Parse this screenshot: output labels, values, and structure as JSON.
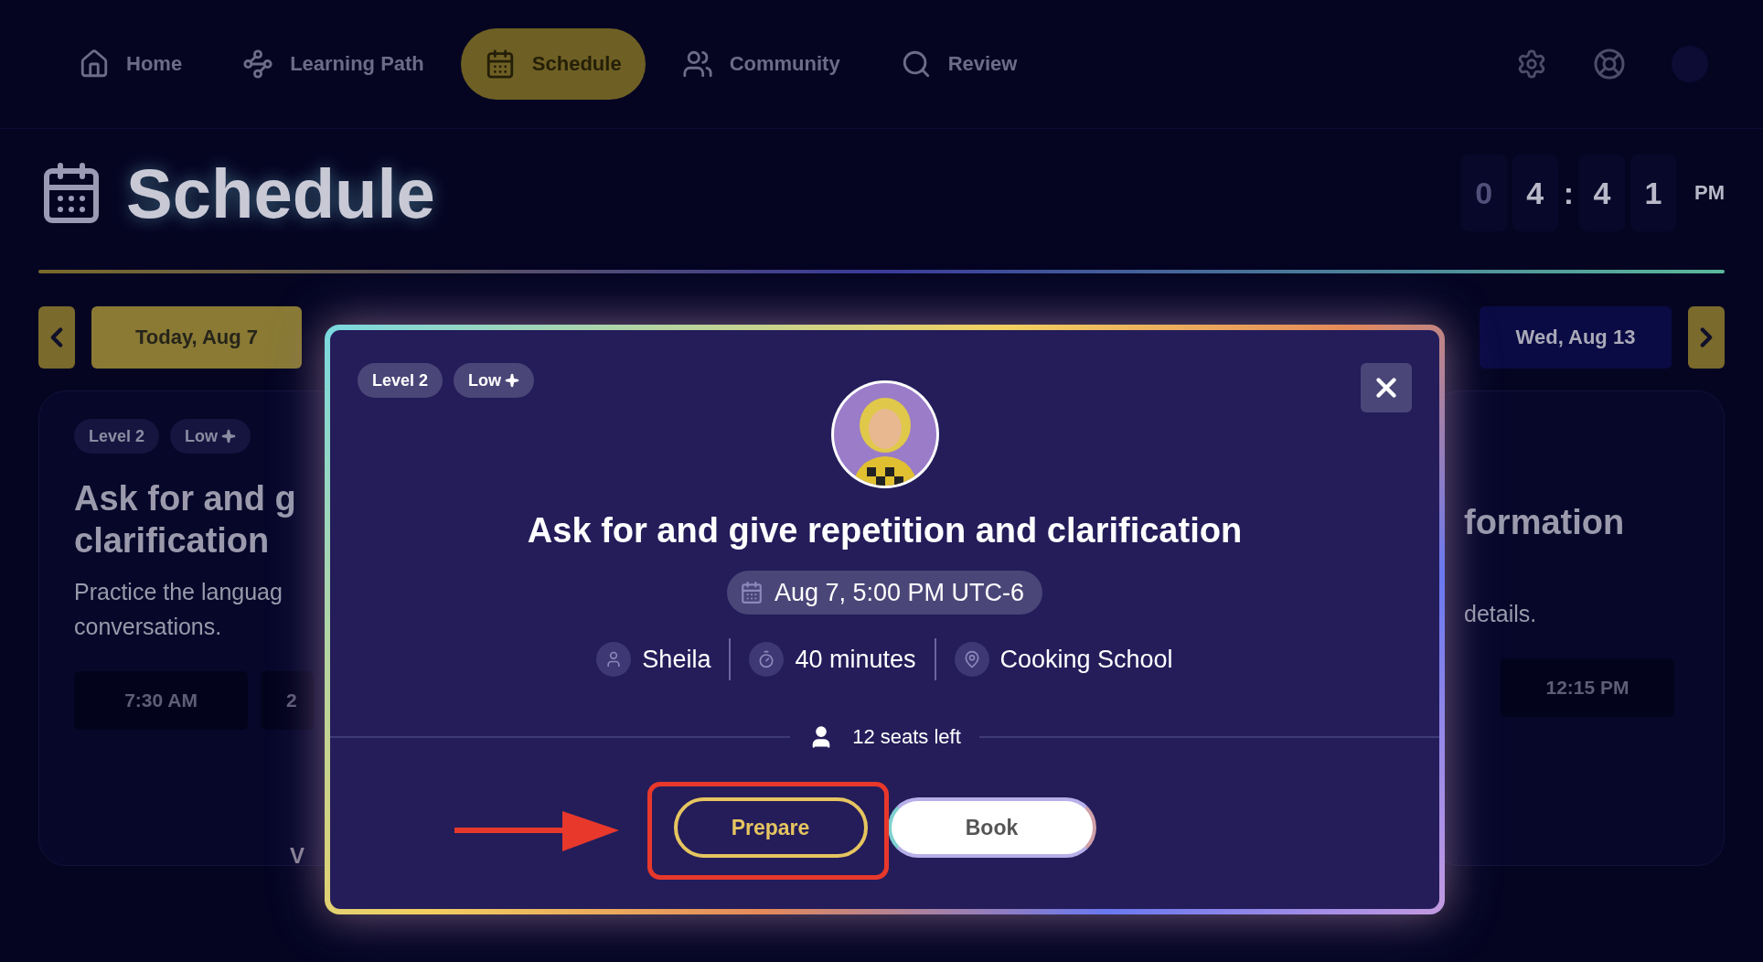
{
  "nav": {
    "items": [
      {
        "label": "Home",
        "selected": false
      },
      {
        "label": "Learning Path",
        "selected": false
      },
      {
        "label": "Schedule",
        "selected": true
      },
      {
        "label": "Community",
        "selected": false
      },
      {
        "label": "Review",
        "selected": false
      }
    ]
  },
  "header": {
    "title": "Schedule",
    "clock": [
      {
        "text": "0",
        "dim": true
      },
      {
        "text": "4",
        "dim": false
      },
      {
        "text": ":",
        "kind": "sep"
      },
      {
        "text": "4",
        "dim": false
      },
      {
        "text": "1",
        "dim": false
      }
    ],
    "period": "PM"
  },
  "date_nav": {
    "current": "Today, Aug 7",
    "next": "Wed, Aug 13"
  },
  "cards": [
    {
      "tags": [
        "Level 2",
        "Low"
      ],
      "title_lines": [
        "Ask for and g",
        "clarification"
      ],
      "description_lines": [
        "Practice the languag",
        "conversations."
      ],
      "times": [
        "7:30 AM",
        "2"
      ],
      "link": "V"
    },
    {
      "title_lines": [
        "formation"
      ],
      "description_lines": [
        "details."
      ],
      "times": [
        "12:15 PM"
      ]
    }
  ],
  "modal": {
    "tags": [
      "Level 2",
      "Low"
    ],
    "title": "Ask for and give repetition and clarification",
    "datetime": "Aug 7, 5:00 PM UTC-6",
    "meta": [
      {
        "kind": "host",
        "text": "Sheila"
      },
      {
        "kind": "duration",
        "text": "40 minutes"
      },
      {
        "kind": "location",
        "text": "Cooking School"
      }
    ],
    "seats": "12 seats left",
    "actions": [
      {
        "label": "Prepare",
        "kind": "outline"
      },
      {
        "label": "Book",
        "kind": "solid"
      }
    ]
  }
}
